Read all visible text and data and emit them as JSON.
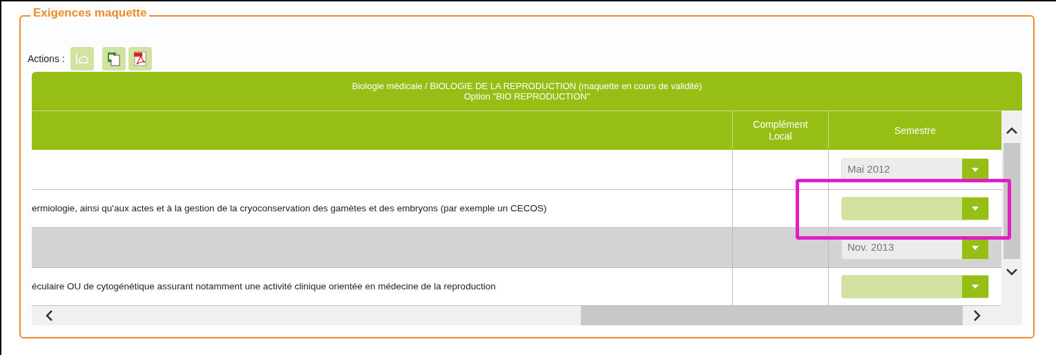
{
  "panel": {
    "title": "Exigences maquette"
  },
  "actions": {
    "label": "Actions :"
  },
  "table": {
    "caption": [
      "Biologie médicale / BIOLOGIE DE LA REPRODUCTION (maquette en cours de validité)",
      "Option \"BIO REPRODUCTION\""
    ],
    "columns": [
      "Complément Local",
      "Semestre"
    ],
    "rows": [
      {
        "text": null,
        "selected": false,
        "highlighted": false,
        "semester": "Mai 2012"
      },
      {
        "text": "ermiologie, ainsi qu'aux actes et à la gestion de la cryoconservation des gamètes et des embryons (par exemple un CECOS)",
        "selected": false,
        "highlighted": true,
        "semester": null
      },
      {
        "text": null,
        "selected": true,
        "highlighted": false,
        "semester": "Nov. 2013"
      },
      {
        "text": "éculaire OU de cytogénétique assurant notamment une activité clinique orientée en médecine de la reproduction",
        "selected": false,
        "highlighted": false,
        "semester": null
      }
    ]
  }
}
